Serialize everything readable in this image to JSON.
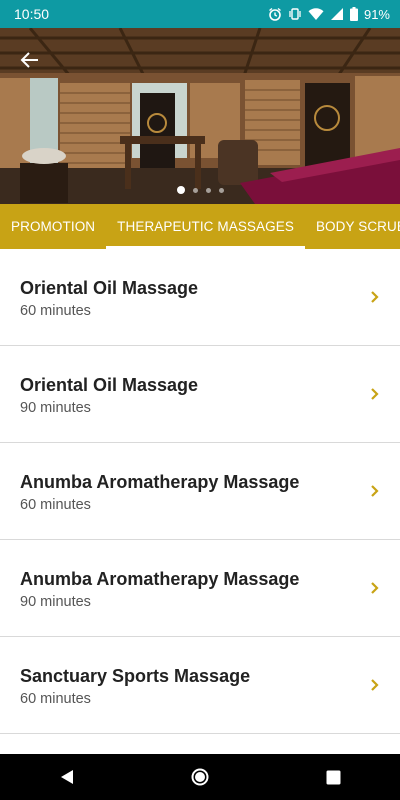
{
  "status": {
    "time": "10:50",
    "battery": "91%"
  },
  "hero": {
    "slide_count": 4,
    "active_slide": 1
  },
  "tabs": [
    {
      "label": "PROMOTION",
      "active": false
    },
    {
      "label": "THERAPEUTIC MASSAGES",
      "active": true
    },
    {
      "label": "BODY SCRUBS",
      "active": false
    }
  ],
  "items": [
    {
      "title": "Oriental Oil Massage",
      "duration": "60 minutes"
    },
    {
      "title": "Oriental Oil Massage",
      "duration": "90 minutes"
    },
    {
      "title": "Anumba Aromatherapy Massage",
      "duration": "60 minutes"
    },
    {
      "title": "Anumba Aromatherapy Massage",
      "duration": "90 minutes"
    },
    {
      "title": "Sanctuary Sports Massage",
      "duration": "60 minutes"
    }
  ],
  "colors": {
    "status_bar": "#0e9aa3",
    "tab_bar": "#c8a315",
    "chevron": "#c8a315"
  },
  "icons": [
    "alarm-icon",
    "vibrate-icon",
    "wifi-icon",
    "signal-icon",
    "battery-icon",
    "back-arrow-icon",
    "chevron-right-icon",
    "nav-back-icon",
    "nav-home-icon",
    "nav-recents-icon"
  ]
}
